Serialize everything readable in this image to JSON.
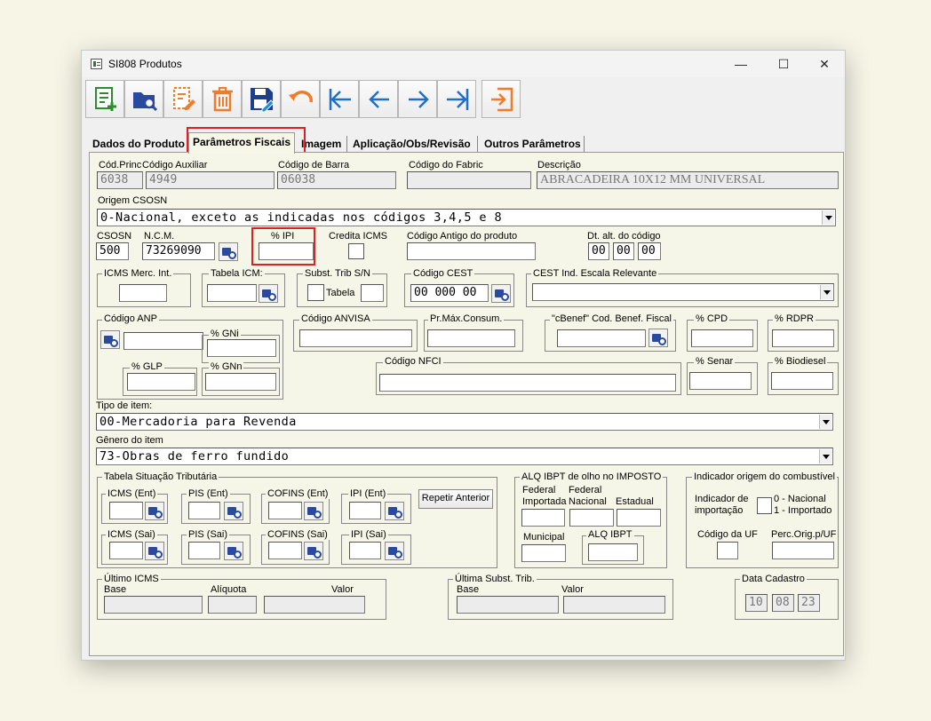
{
  "window": {
    "title": "SI808 Produtos"
  },
  "window_controls": {
    "minimize": "—",
    "maximize": "☐",
    "close": "✕"
  },
  "toolbar": [
    {
      "name": "new-record-button",
      "icon": "add-document-icon"
    },
    {
      "name": "search-button",
      "icon": "folder-search-icon"
    },
    {
      "name": "edit-button",
      "icon": "edit-document-icon"
    },
    {
      "name": "delete-button",
      "icon": "trash-icon"
    },
    {
      "name": "save-button",
      "icon": "save-icon"
    },
    {
      "name": "undo-button",
      "icon": "undo-icon"
    },
    {
      "name": "first-record-button",
      "icon": "first-icon"
    },
    {
      "name": "previous-record-button",
      "icon": "previous-icon"
    },
    {
      "name": "next-record-button",
      "icon": "next-icon"
    },
    {
      "name": "last-record-button",
      "icon": "last-icon"
    },
    {
      "name": "exit-button",
      "icon": "exit-icon"
    }
  ],
  "tabs": [
    "Dados do  Produto",
    "Parâmetros Fiscais",
    "Imagem",
    "Aplicação/Obs/Revisão",
    "Outros Parâmetros"
  ],
  "header": {
    "cod_princ_label": "Cód.Princ",
    "cod_princ": "6038",
    "cod_aux_label": "Código Auxiliar",
    "cod_aux": "4949",
    "cod_barra_label": "Código de Barra",
    "cod_barra": "06038",
    "cod_fabric_label": "Código do Fabric",
    "cod_fabric": "",
    "descricao_label": "Descrição",
    "descricao": "ABRACADEIRA 10X12 MM UNIVERSAL"
  },
  "origem": {
    "label": "Origem CSOSN",
    "value": "0-Nacional, exceto as indicadas nos códigos 3,4,5 e 8"
  },
  "row1": {
    "csosn_label": "CSOSN",
    "csosn": "500",
    "ncm_label": "N.C.M.",
    "ncm": "73269090",
    "ipi_label": "% IPI",
    "ipi": "",
    "credita_label": "Credita ICMS",
    "cod_antigo_label": "Código Antigo do produto",
    "cod_antigo": "",
    "dt_alt_label": "Dt. alt. do código",
    "dt_d": "00",
    "dt_m": "00",
    "dt_y": "00"
  },
  "row2": {
    "icms_merc_label": "ICMS Merc. Int.",
    "tabela_icm_label": "Tabela ICM:",
    "subst_label": "Subst. Trib S/N",
    "tabela_label": "Tabela",
    "cest_label": "Código CEST",
    "cest": "00 000 00",
    "cest_escala_label": "CEST Ind. Escala Relevante"
  },
  "row3": {
    "anp_label": "Código ANP",
    "gni_label": "% GNi",
    "glp_label": "% GLP",
    "gnn_label": "% GNn",
    "anvisa_label": "Código ANVISA",
    "prmax_label": "Pr.Máx.Consum.",
    "cbenef_label": "\"cBenef\" Cod. Benef. Fiscal",
    "cpd_label": "% CPD",
    "rdpr_label": "% RDPR",
    "nfci_label": "Código NFCI",
    "senar_label": "% Senar",
    "biodiesel_label": "% Biodiesel"
  },
  "tipo_item": {
    "label": "Tipo de item:",
    "value": "00-Mercadoria para Revenda"
  },
  "genero_item": {
    "label": "Gênero do item",
    "value": "73-Obras de ferro fundido"
  },
  "tst": {
    "title": "Tabela Situação Tributária",
    "icms_ent": "ICMS (Ent)",
    "pis_ent": "PIS (Ent)",
    "cofins_ent": "COFINS (Ent)",
    "ipi_ent": "IPI (Ent)",
    "icms_sai": "ICMS (Sai)",
    "pis_sai": "PIS (Sai)",
    "cofins_sai": "COFINS (Sai)",
    "ipi_sai": "IPI (Sai)",
    "repetir": "Repetir Anterior"
  },
  "ibpt": {
    "title": "ALQ IBPT de olho no IMPOSTO",
    "fed_imp": "Federal\nImportada",
    "fed_nac": "Federal\nNacional",
    "estadual": "Estadual",
    "municipal": "Municipal",
    "alq": "ALQ IBPT"
  },
  "comb": {
    "title": "Indicador origem do combustível",
    "ind_import": "Indicador de\nimportação",
    "opcoes": "0 - Nacional\n1 - Importado",
    "cod_uf": "Código da UF",
    "perc": "Perc.Orig.p/UF"
  },
  "ultimo_icms": {
    "title": "Último ICMS",
    "base": "Base",
    "aliquota": "Alíquota",
    "valor": "Valor"
  },
  "ultima_st": {
    "title": "Última Subst. Trib.",
    "base": "Base",
    "valor": "Valor"
  },
  "data_cadastro": {
    "title": "Data Cadastro",
    "d": "10",
    "m": "08",
    "y": "23"
  }
}
